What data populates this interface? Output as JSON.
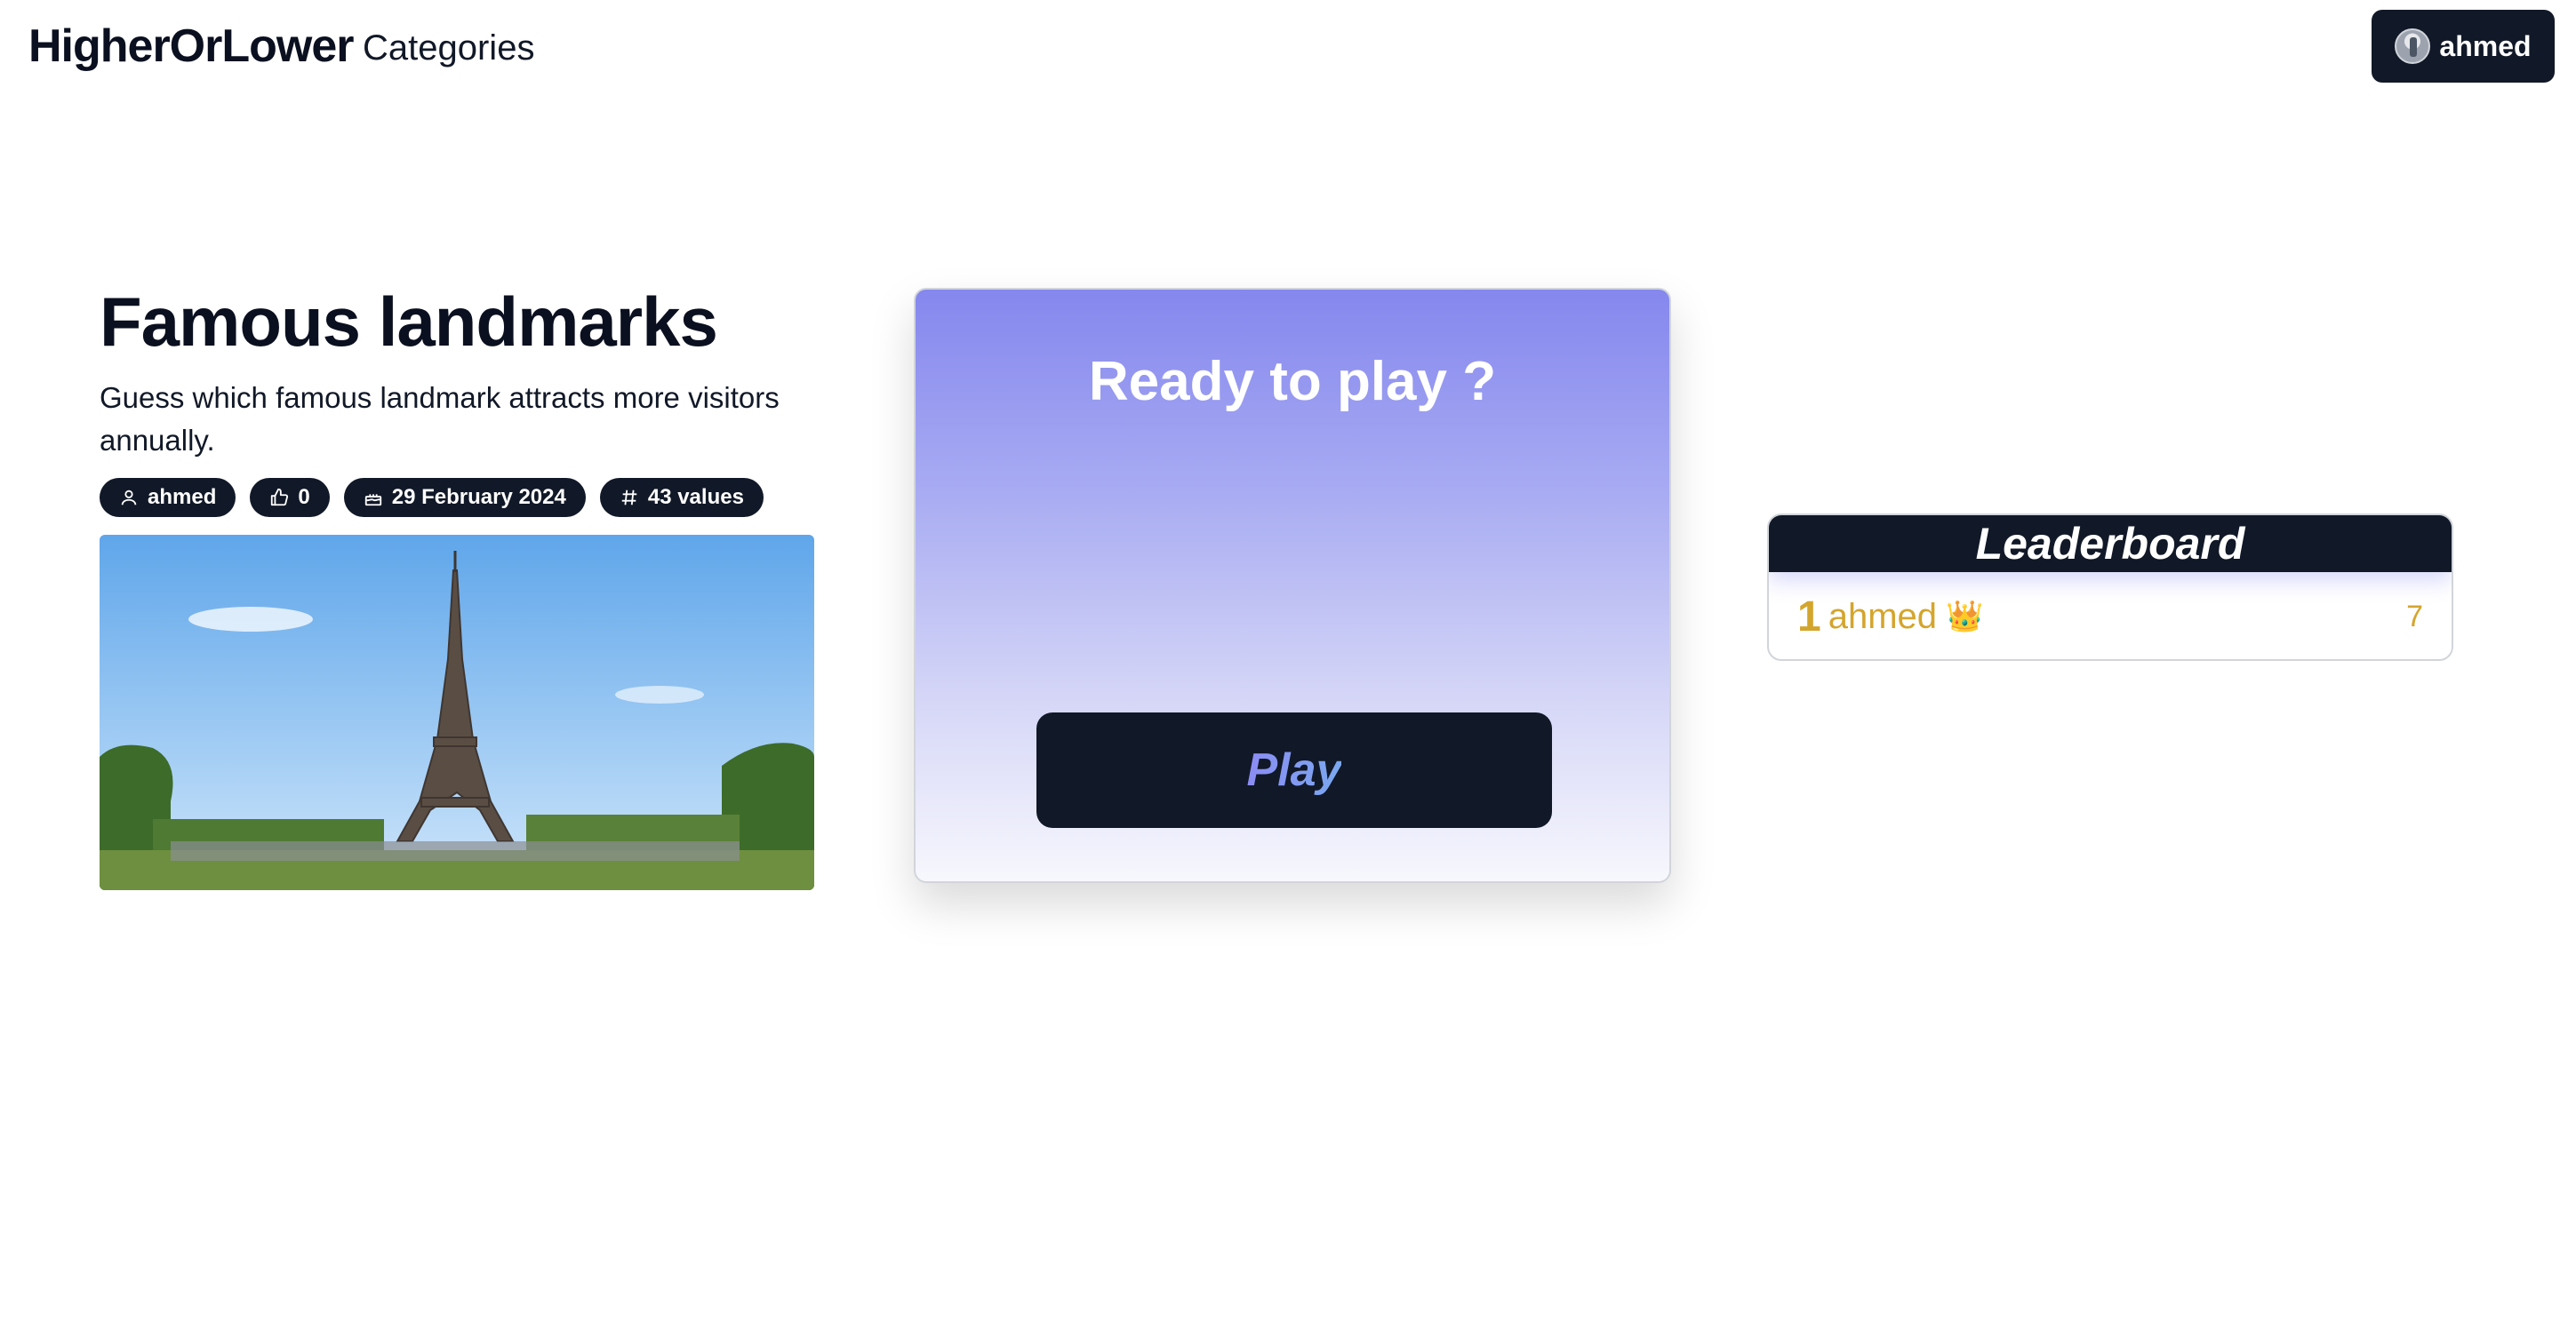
{
  "header": {
    "brand": "HigherOrLower",
    "nav_categories": "Categories",
    "user_name": "ahmed"
  },
  "category": {
    "title": "Famous landmarks",
    "description": "Guess which famous landmark attracts more visitors annually.",
    "badges": {
      "author": "ahmed",
      "likes": "0",
      "date": "29 February 2024",
      "values": "43 values"
    }
  },
  "play_card": {
    "title": "Ready to play ?",
    "play_label": "Play"
  },
  "leaderboard": {
    "title": "Leaderboard",
    "entries": [
      {
        "rank": "1",
        "name": "ahmed",
        "badge": "👑",
        "score": "7"
      }
    ]
  },
  "colors": {
    "primary_dark": "#111827",
    "gold": "#d4a52d",
    "card_gradient_top": "#8587ee",
    "card_gradient_bottom": "#f7f7fd"
  },
  "icons": {
    "author": "user-icon",
    "likes": "thumbs-up-icon",
    "date": "cake-icon",
    "values": "hash-icon"
  }
}
